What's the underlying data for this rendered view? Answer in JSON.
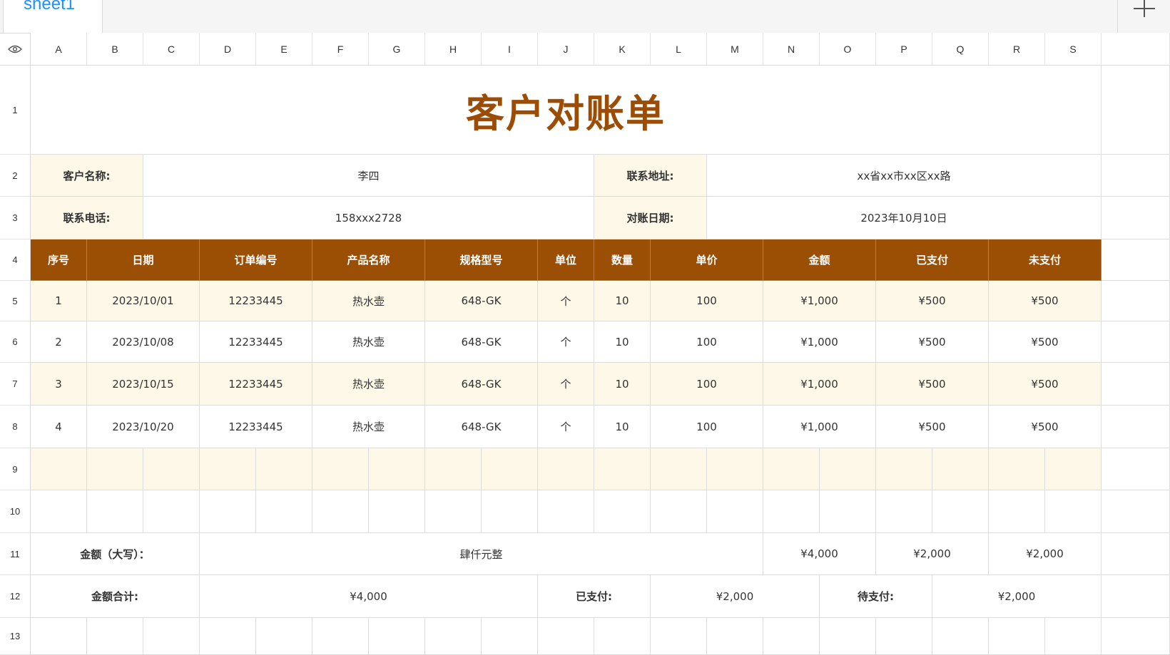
{
  "tabs": {
    "sheet_name": "sheet1"
  },
  "columns": [
    "A",
    "B",
    "C",
    "D",
    "E",
    "F",
    "G",
    "H",
    "I",
    "J",
    "K",
    "L",
    "M",
    "N",
    "O",
    "P",
    "Q",
    "R",
    "S"
  ],
  "rows": [
    "1",
    "2",
    "3",
    "4",
    "5",
    "6",
    "7",
    "8",
    "9",
    "10",
    "11",
    "12",
    "13"
  ],
  "sheet": {
    "title": "客户对账单",
    "customer_name_label": "客户名称:",
    "customer_name": "李四",
    "address_label": "联系地址:",
    "address": "xx省xx市xx区xx路",
    "phone_label": "联系电话:",
    "phone": "158xxx2728",
    "date_label": "对账日期:",
    "date": "2023年10月10日",
    "table_headers": [
      "序号",
      "日期",
      "订单编号",
      "产品名称",
      "规格型号",
      "单位",
      "数量",
      "单价",
      "金额",
      "已支付",
      "未支付"
    ],
    "table_rows": [
      [
        "1",
        "2023/10/01",
        "12233445",
        "热水壶",
        "648-GK",
        "个",
        "10",
        "100",
        "¥1,000",
        "¥500",
        "¥500"
      ],
      [
        "2",
        "2023/10/08",
        "12233445",
        "热水壶",
        "648-GK",
        "个",
        "10",
        "100",
        "¥1,000",
        "¥500",
        "¥500"
      ],
      [
        "3",
        "2023/10/15",
        "12233445",
        "热水壶",
        "648-GK",
        "个",
        "10",
        "100",
        "¥1,000",
        "¥500",
        "¥500"
      ],
      [
        "4",
        "2023/10/20",
        "12233445",
        "热水壶",
        "648-GK",
        "个",
        "10",
        "100",
        "¥1,000",
        "¥500",
        "¥500"
      ]
    ],
    "amount_words_label": "金额（大写）：",
    "amount_words": "肆仟元整",
    "sum_amount": "¥4,000",
    "sum_paid": "¥2,000",
    "sum_unpaid": "¥2,000",
    "total_label": "金额合计:",
    "total_value": "¥4,000",
    "paid_label": "已支付:",
    "paid_value": "¥2,000",
    "pending_label": "待支付:",
    "pending_value": "¥2,000"
  },
  "colors": {
    "header_brown": "#9b4f05",
    "title_brown": "#9b4d06",
    "band_cream": "#fdf8e8",
    "tab_blue": "#1e90ff"
  },
  "icons": {
    "corner": "eye-icon",
    "add_sheet": "plus-icon"
  }
}
